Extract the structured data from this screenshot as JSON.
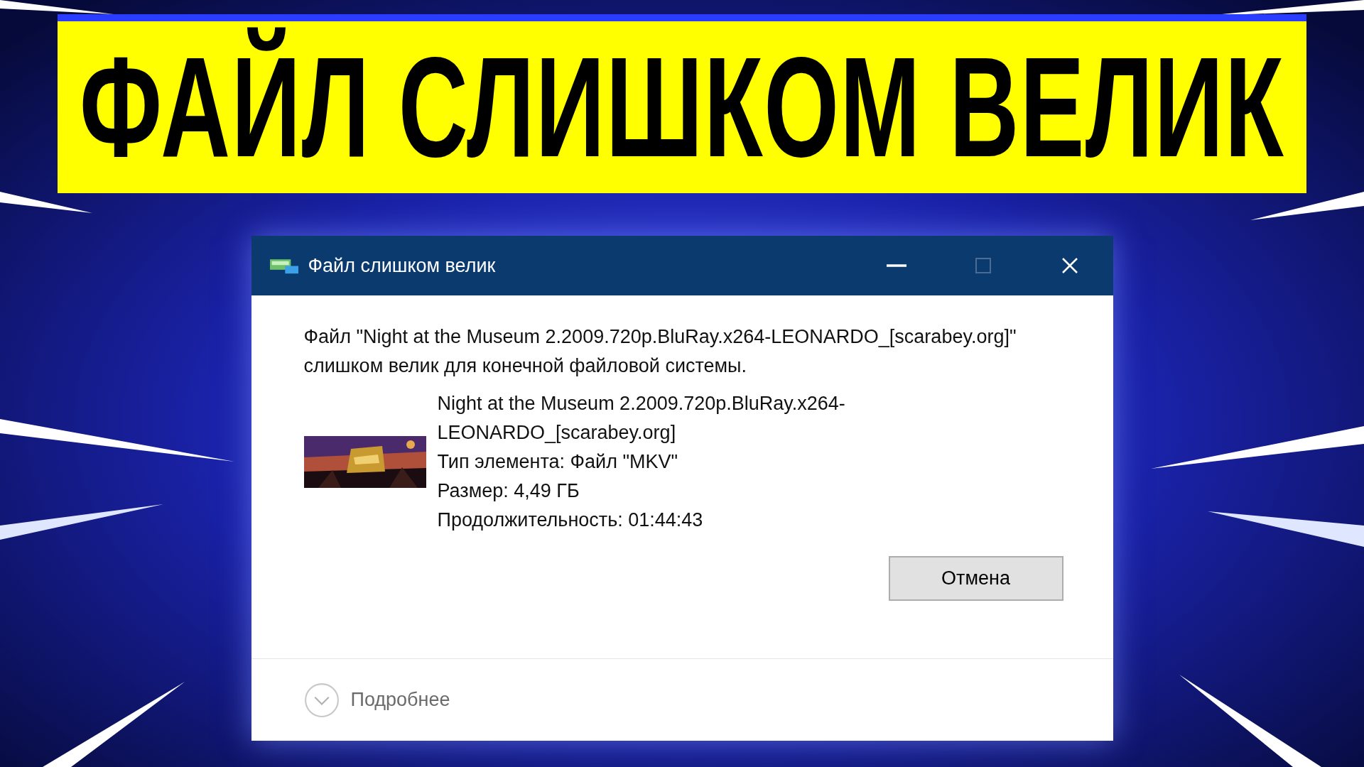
{
  "banner": {
    "title": "ФАЙЛ СЛИШКОМ ВЕЛИК"
  },
  "dialog": {
    "title": "Файл слишком велик",
    "controls": [
      {
        "kind": "minimize",
        "disabled": false
      },
      {
        "kind": "maximize",
        "disabled": true
      },
      {
        "kind": "close",
        "disabled": false
      }
    ],
    "message": "Файл \"Night at the Museum 2.2009.720p.BluRay.x264-LEONARDO_[scarabey.org]\" слишком велик для конечной файловой системы.",
    "file": {
      "name": "Night at the Museum 2.2009.720p.BluRay.x264-LEONARDO_[scarabey.org]",
      "type": "Тип элемента: Файл \"MKV\"",
      "size": "Размер: 4,49 ГБ",
      "duration": "Продолжительность: 01:44:43"
    },
    "buttons": [
      {
        "label": "Отмена"
      }
    ],
    "details": {
      "label": "Подробнее",
      "expanded": false
    }
  }
}
